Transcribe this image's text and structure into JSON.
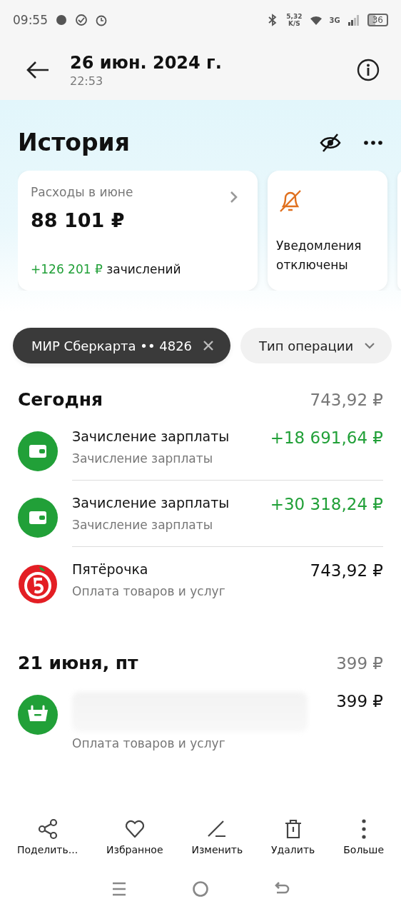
{
  "status_bar": {
    "time": "09:55",
    "speed": "5,32",
    "speed_unit": "K/S",
    "network": "3G",
    "battery": "36"
  },
  "header": {
    "title": "26 июн. 2024 г.",
    "subtitle": "22:53"
  },
  "page_title": "История",
  "summary_card": {
    "label": "Расходы в июне",
    "amount": "88 101 ₽",
    "income": "+126 201 ₽",
    "income_suffix": "зачислений"
  },
  "notice_card": {
    "text": "Уведомления отключены"
  },
  "filters": [
    {
      "label": "МИР Сберкарта •• 4826",
      "kind": "card"
    },
    {
      "label": "Тип операции",
      "kind": "dropdown"
    }
  ],
  "groups": [
    {
      "title": "Сегодня",
      "total": "743,92 ₽",
      "items": [
        {
          "kind": "wallet",
          "title": "Зачисление зарплаты",
          "subtitle": "Зачисление зарплаты",
          "amount": "+18 691,64 ₽",
          "incoming": true
        },
        {
          "kind": "wallet",
          "title": "Зачисление зарплаты",
          "subtitle": "Зачисление зарплаты",
          "amount": "+30 318,24 ₽",
          "incoming": true
        },
        {
          "kind": "store",
          "title": "Пятёрочка",
          "subtitle": "Оплата товаров и услуг",
          "amount": "743,92 ₽",
          "incoming": false
        }
      ]
    },
    {
      "title": "21 июня, пт",
      "total": "399 ₽",
      "items": [
        {
          "kind": "basket",
          "subtitle": "Оплата товаров и услуг",
          "amount": "399 ₽",
          "incoming": false
        }
      ]
    }
  ],
  "actions": [
    {
      "kind": "share",
      "label": "Поделить..."
    },
    {
      "kind": "favorite",
      "label": "Избранное"
    },
    {
      "kind": "edit",
      "label": "Изменить"
    },
    {
      "kind": "delete",
      "label": "Удалить"
    },
    {
      "kind": "more",
      "label": "Больше"
    }
  ]
}
